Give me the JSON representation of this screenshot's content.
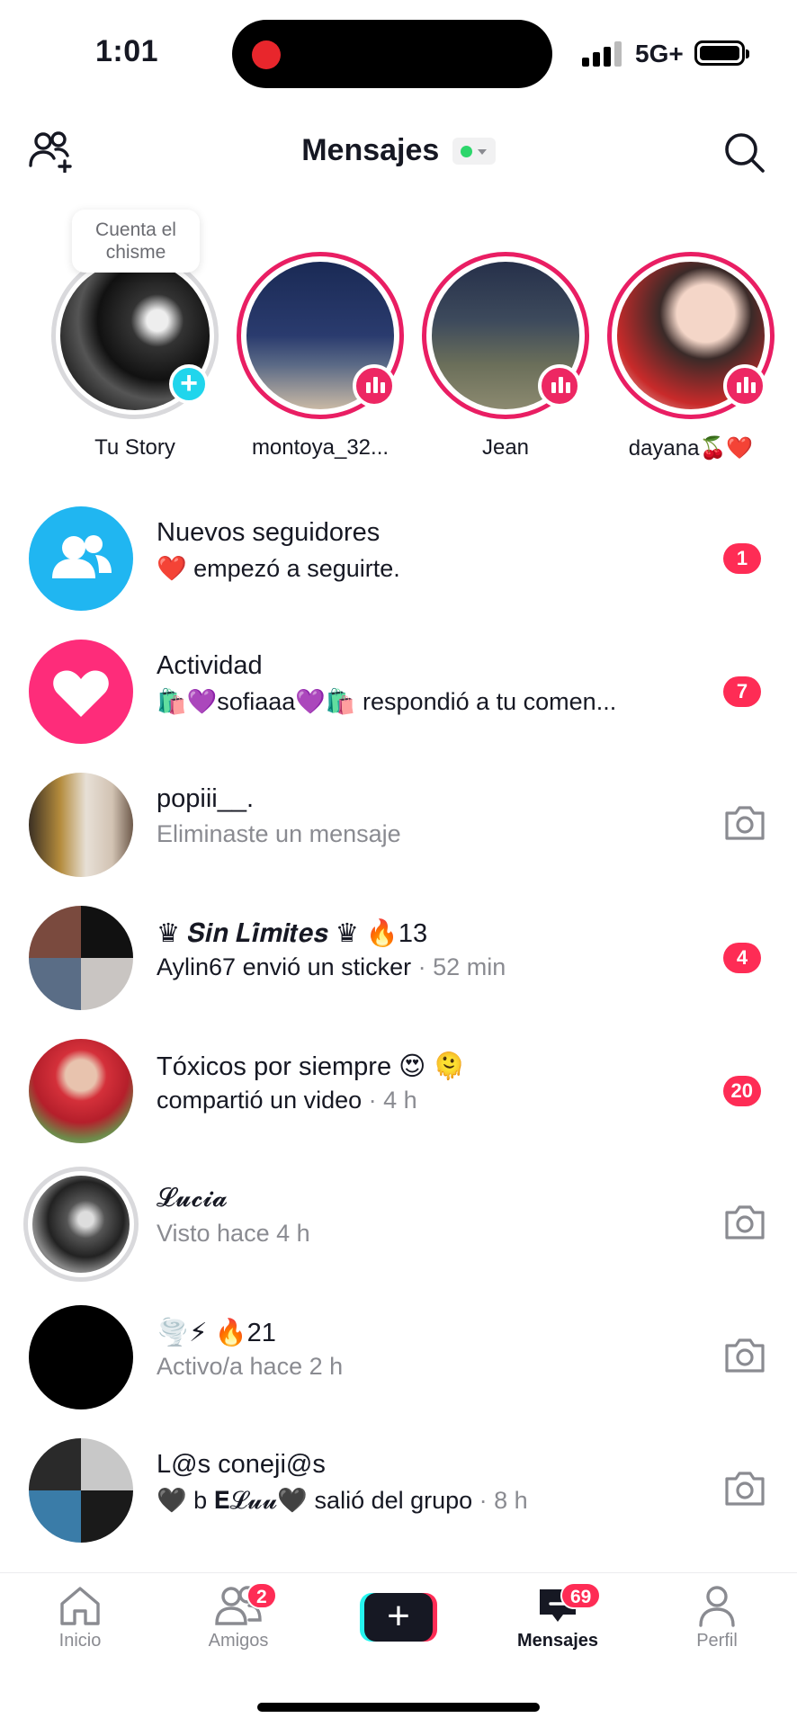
{
  "status_bar": {
    "time": "1:01",
    "network": "5G+"
  },
  "header": {
    "title": "Mensajes",
    "online_color": "#2cd66b"
  },
  "stories": {
    "tooltip": "Cuenta el chisme",
    "items": [
      {
        "name": "Tu Story",
        "type": "own"
      },
      {
        "name": "montoya_32...",
        "type": "live"
      },
      {
        "name": "Jean",
        "type": "live"
      },
      {
        "name": "dayana🍒❤️",
        "type": "live"
      }
    ]
  },
  "conversations": [
    {
      "name": "Nuevos seguidores",
      "sub": "❤️ empezó a seguirte.",
      "meta": "",
      "badge": "1",
      "icon": "followers-icon"
    },
    {
      "name": "Actividad",
      "sub": "🛍️💜sofiaaa💜🛍️ respondió a tu comen...",
      "meta": "",
      "badge": "7",
      "icon": "heart-icon"
    },
    {
      "name": "popiii__.",
      "sub": "Eliminaste un mensaje",
      "meta": "",
      "badge": "",
      "icon": "camera-icon"
    },
    {
      "name": "♛ 𝑺𝒊𝒏 𝑳𝒊́𝒎𝒊𝒕𝒆𝒔 ♛ 🔥13",
      "sub": "Aylin67 envió un sticker",
      "meta": " · 52 min",
      "badge": "4",
      "icon": ""
    },
    {
      "name": "Tóxicos por siempre 😍 🫠",
      "sub": "compartió un video",
      "meta": " · 4 h",
      "badge": "20",
      "icon": ""
    },
    {
      "name": "𝓛𝓾𝓬𝓲𝓪",
      "sub": "Visto hace 4 h",
      "meta": "",
      "badge": "",
      "icon": "camera-icon"
    },
    {
      "name": "🌪️⚡ 🔥21",
      "sub": "Activo/a hace 2 h",
      "meta": "",
      "badge": "",
      "icon": "camera-icon"
    },
    {
      "name": "L@s coneji@s",
      "sub": "🖤 b 𝐄𝓛𝓾𝓾🖤 salió del grupo",
      "meta": " · 8 h",
      "badge": "",
      "icon": "camera-icon"
    }
  ],
  "tabbar": {
    "home": "Inicio",
    "friends": "Amigos",
    "friends_badge": "2",
    "create": "+",
    "inbox": "Mensajes",
    "inbox_badge": "69",
    "profile": "Perfil"
  }
}
